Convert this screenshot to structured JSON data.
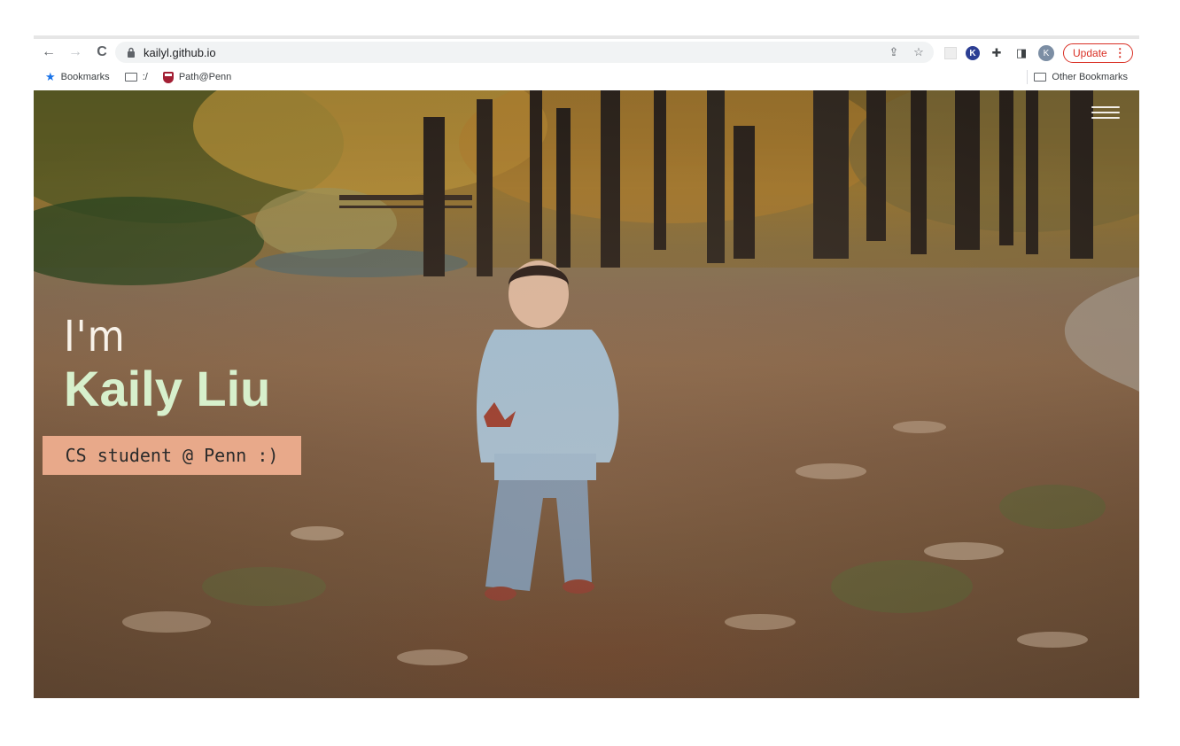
{
  "browser": {
    "url": "kailyl.github.io",
    "update_label": "Update",
    "update_menu_glyph": "⋮",
    "avatar_initial": "K",
    "extension_initial": "K",
    "icons": {
      "back": "←",
      "forward": "→",
      "reload": "C",
      "share": "⇪",
      "star": "☆",
      "puzzle": "✚",
      "sidepanel": "◨"
    },
    "accent_color": "#d93025"
  },
  "bookmarks_bar": {
    "items": [
      {
        "label": "Bookmarks",
        "icon": "star-icon"
      },
      {
        "label": ":/",
        "icon": "folder-icon"
      },
      {
        "label": "Path@Penn",
        "icon": "penn-shield-icon"
      }
    ],
    "other_label": "Other Bookmarks"
  },
  "hero": {
    "greeting": "I'm",
    "name": "Kaily Liu",
    "tagline": "CS student @ Penn :)",
    "name_color": "#d7f0cc",
    "tagline_bg": "#e8a98a",
    "menu_icon": "hamburger-menu-icon"
  }
}
